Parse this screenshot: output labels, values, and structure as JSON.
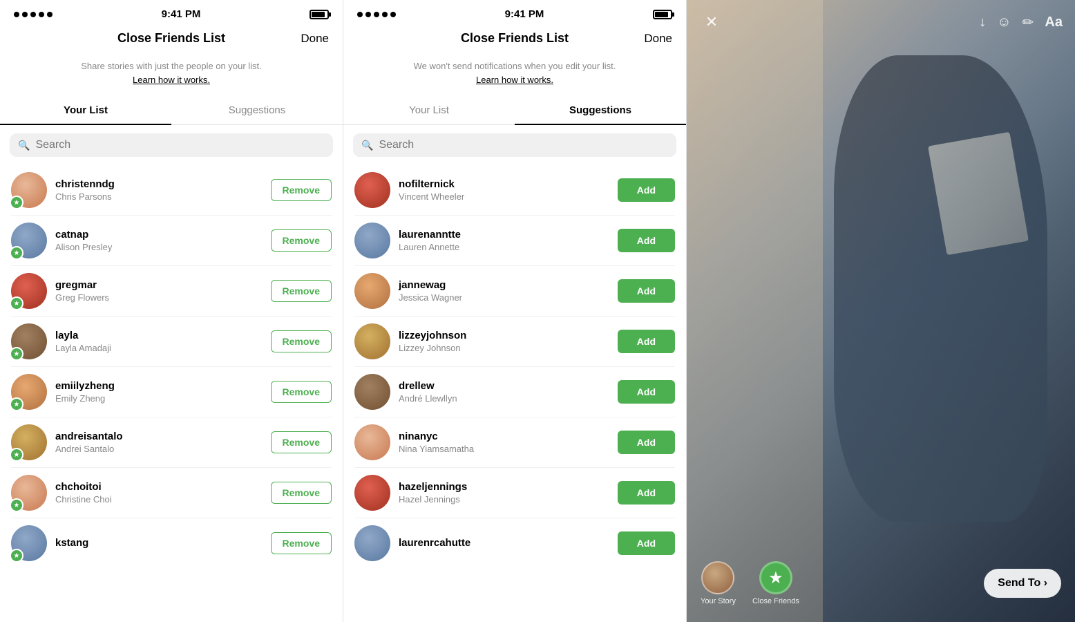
{
  "panel1": {
    "statusBar": {
      "dots": 5,
      "time": "9:41 PM"
    },
    "header": {
      "title": "Close Friends List",
      "doneLabel": "Done"
    },
    "subtitle": "Share stories with just the people on your list.",
    "learnMore": "Learn how it works.",
    "tabs": [
      {
        "label": "Your List",
        "active": true
      },
      {
        "label": "Suggestions",
        "active": false
      }
    ],
    "search": {
      "placeholder": "Search"
    },
    "users": [
      {
        "handle": "christenndg",
        "name": "Chris Parsons",
        "avatarClass": "av-shape-1"
      },
      {
        "handle": "catnap",
        "name": "Alison Presley",
        "avatarClass": "av-shape-2"
      },
      {
        "handle": "gregmar",
        "name": "Greg Flowers",
        "avatarClass": "av-shape-3"
      },
      {
        "handle": "layla",
        "name": "Layla Amadaji",
        "avatarClass": "av-shape-4"
      },
      {
        "handle": "emiilyzheng",
        "name": "Emily Zheng",
        "avatarClass": "av-shape-5"
      },
      {
        "handle": "andreisantalo",
        "name": "Andrei Santalo",
        "avatarClass": "av-shape-6"
      },
      {
        "handle": "chchoitoi",
        "name": "Christine Choi",
        "avatarClass": "av-shape-1"
      },
      {
        "handle": "kstang",
        "name": "",
        "avatarClass": "av-shape-2"
      }
    ],
    "removeLabel": "Remove"
  },
  "panel2": {
    "statusBar": {
      "dots": 5,
      "time": "9:41 PM"
    },
    "header": {
      "title": "Close Friends List",
      "doneLabel": "Done"
    },
    "subtitle": "We won't send notifications when you edit your list.",
    "learnMore": "Learn how it works.",
    "tabs": [
      {
        "label": "Your List",
        "active": false
      },
      {
        "label": "Suggestions",
        "active": true
      }
    ],
    "search": {
      "placeholder": "Search"
    },
    "users": [
      {
        "handle": "nofilternick",
        "name": "Vincent Wheeler",
        "avatarClass": "av-shape-3"
      },
      {
        "handle": "laurenanntte",
        "name": "Lauren Annette",
        "avatarClass": "av-shape-2"
      },
      {
        "handle": "jannewag",
        "name": "Jessica Wagner",
        "avatarClass": "av-shape-5"
      },
      {
        "handle": "lizzeyjohnson",
        "name": "Lizzey Johnson",
        "avatarClass": "av-shape-6"
      },
      {
        "handle": "drellew",
        "name": "André Llewllyn",
        "avatarClass": "av-shape-4"
      },
      {
        "handle": "ninanyc",
        "name": "Nina Yiamsamatha",
        "avatarClass": "av-shape-1"
      },
      {
        "handle": "hazeljennings",
        "name": "Hazel Jennings",
        "avatarClass": "av-shape-3"
      },
      {
        "handle": "laurenrcahutte",
        "name": "",
        "avatarClass": "av-shape-2"
      }
    ],
    "addLabel": "Add"
  },
  "panel3": {
    "icons": {
      "close": "✕",
      "download": "↓",
      "smiley": "☺",
      "edit": "✏",
      "text": "Aa"
    },
    "bottomBar": {
      "yourStoryLabel": "Your Story",
      "closeFriendsLabel": "Close Friends",
      "sendToLabel": "Send To ›"
    }
  }
}
